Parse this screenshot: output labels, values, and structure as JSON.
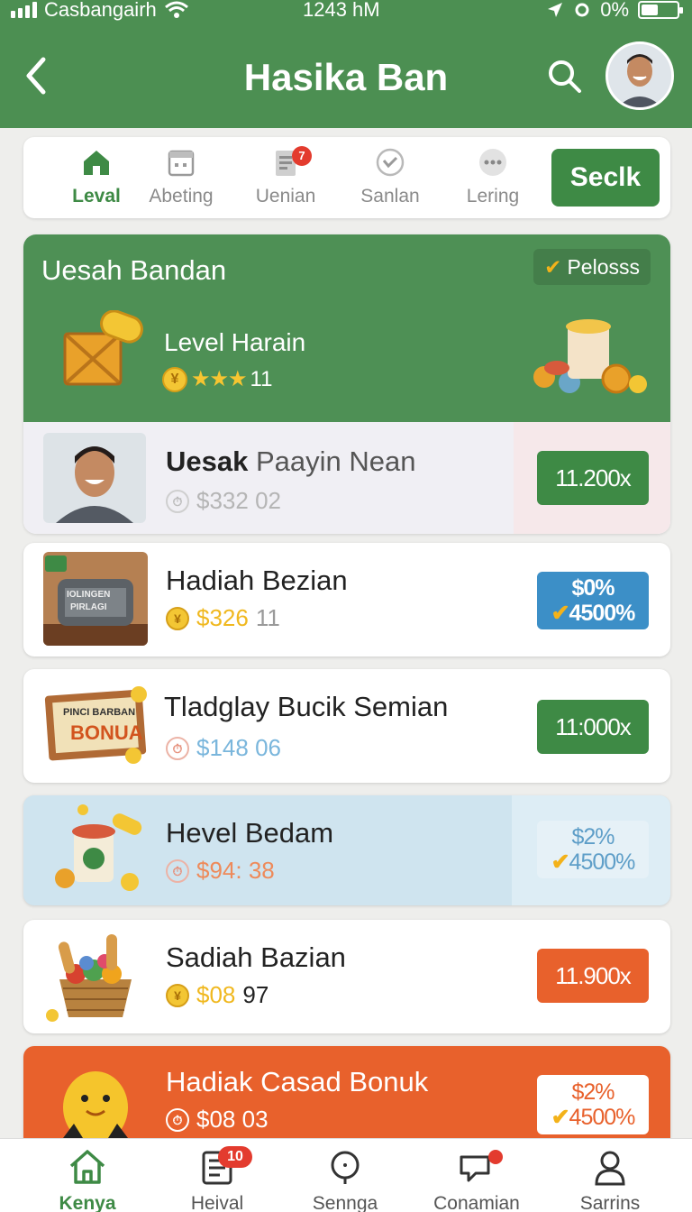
{
  "status_bar": {
    "carrier": "Casbangairh",
    "time": "1243 hM",
    "battery_pct": "0%"
  },
  "header": {
    "title": "Hasika Ban"
  },
  "tabs": [
    {
      "label": "Leval",
      "active": true,
      "icon": "home-icon"
    },
    {
      "label": "Abeting",
      "active": false,
      "icon": "calendar-icon"
    },
    {
      "label": "Uenian",
      "active": false,
      "icon": "document-icon",
      "badge": "7"
    },
    {
      "label": "Sanlan",
      "active": false,
      "icon": "check-circle-icon"
    },
    {
      "label": "Lering",
      "active": false,
      "icon": "more-icon"
    }
  ],
  "tabs_action": {
    "label": "Seclk"
  },
  "hero": {
    "title": "Uesah Bandan",
    "chip": "Pelosss",
    "subtitle": "Level Harain",
    "rating_stars": 3,
    "rating_count": "11",
    "row": {
      "name_bold": "Uesak",
      "name_rest": "Paayin Nean",
      "price": "$332 02",
      "button": "11.200x"
    }
  },
  "rewards": [
    {
      "title": "Hadiah Bezian",
      "price": "$326",
      "price_suffix": "11",
      "price_color": "#f0b81f",
      "button_top": "$0%",
      "button_bottom": "4500%",
      "button_style": "blue",
      "thumb_text_1": "IOLINGEN",
      "thumb_text_2": "PIRLAGI"
    },
    {
      "title": "Tladglay Bucik Semian",
      "price": "$148 06",
      "price_suffix": "",
      "price_color": "#7ab6dc",
      "button_top": "11:000x",
      "button_bottom": "",
      "button_style": "green",
      "thumb_text_1": "PINCI BARBAN",
      "thumb_text_2": "BONUA"
    },
    {
      "title": "Hevel Bedam",
      "price": "$94: 38",
      "price_suffix": "",
      "price_color": "#ee8a5a",
      "button_top": "$2%",
      "button_bottom": "4500%",
      "button_style": "pale"
    },
    {
      "title": "Sadiah Bazian",
      "price": "$08",
      "price_suffix": "97",
      "price_color": "#f0b81f",
      "button_top": "11.900x",
      "button_bottom": "",
      "button_style": "orange"
    },
    {
      "title": "Hadiak Casad Bonuk",
      "price": "$08 03",
      "price_suffix": "",
      "price_color": "#ffffff",
      "button_top": "$2%",
      "button_bottom": "4500%",
      "button_style": "white"
    }
  ],
  "bottom_nav": [
    {
      "label": "Kenya",
      "active": true,
      "icon": "home-icon"
    },
    {
      "label": "Heival",
      "active": false,
      "icon": "list-icon",
      "badge": "10"
    },
    {
      "label": "Sennga",
      "active": false,
      "icon": "search-icon"
    },
    {
      "label": "Conamian",
      "active": false,
      "icon": "chat-icon",
      "dot": true
    },
    {
      "label": "Sarrins",
      "active": false,
      "icon": "profile-icon"
    }
  ],
  "colors": {
    "brand_green": "#4c8f52",
    "accent_green": "#3e8a45",
    "accent_orange": "#e8612c",
    "accent_blue": "#3c8fc7"
  }
}
